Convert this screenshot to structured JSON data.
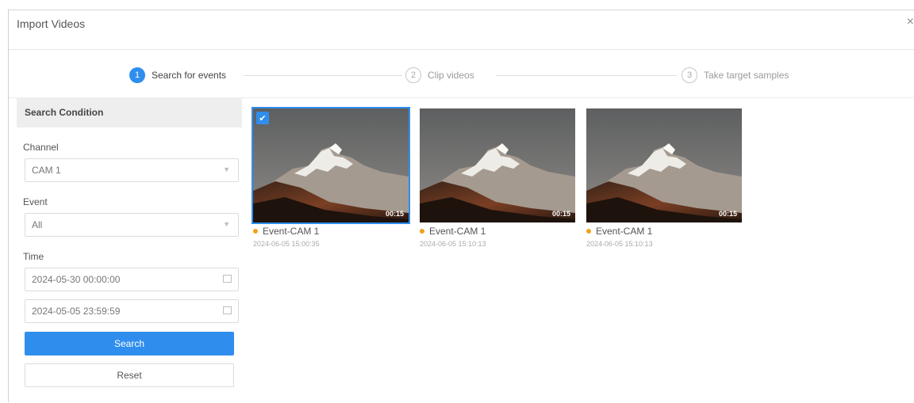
{
  "dialog": {
    "title": "Import Videos",
    "close": "×"
  },
  "steps": [
    {
      "num": "1",
      "label": "Search for events",
      "state": "active"
    },
    {
      "num": "2",
      "label": "Clip videos",
      "state": "todo"
    },
    {
      "num": "3",
      "label": "Take target samples",
      "state": "todo"
    }
  ],
  "sidebar": {
    "header": "Search Condition",
    "channel": {
      "label": "Channel",
      "value": "CAM 1",
      "icon": "chevron-down-icon"
    },
    "event": {
      "label": "Event",
      "value": "All",
      "icon": "chevron-down-icon"
    },
    "time": {
      "label": "Time",
      "start": "2024-05-30 00:00:00",
      "end": "2024-05-05 23:59:59",
      "icon": "calendar-icon"
    },
    "search_button": "Search",
    "reset_button": "Reset"
  },
  "colors": {
    "accent": "#2f8eed",
    "event_dot": "#f0a21a"
  },
  "results": [
    {
      "title": "Event-CAM 1",
      "time": "2024-06-05 15:00:35",
      "duration": "00:15",
      "selected": true
    },
    {
      "title": "Event-CAM 1",
      "time": "2024-06-05 15:10:13",
      "duration": "00:15",
      "selected": false
    },
    {
      "title": "Event-CAM 1",
      "time": "2024-06-05 15:10:13",
      "duration": "00:15",
      "selected": false
    }
  ]
}
